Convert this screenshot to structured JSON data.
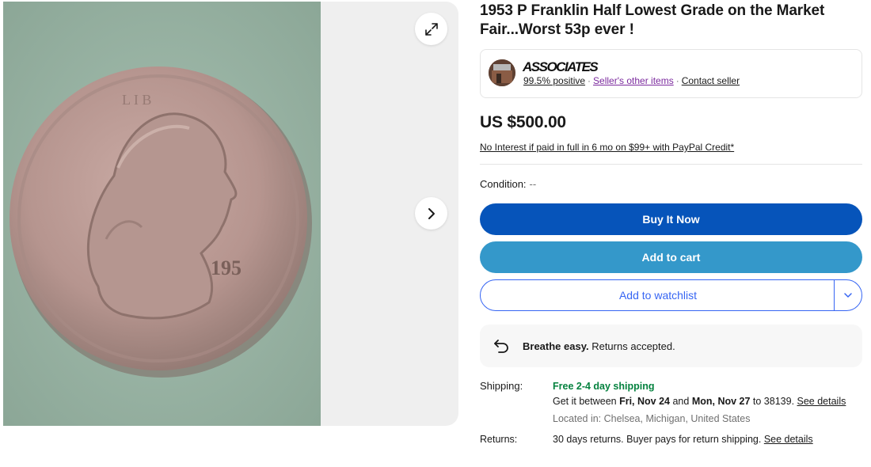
{
  "listing": {
    "title": "1953 P Franklin Half Lowest Grade on the Market Fair...Worst 53p ever !"
  },
  "gallery": {
    "photo_alt": "Coin photo",
    "expand_icon": "expand-icon",
    "next_icon": "chevron-right-icon"
  },
  "seller": {
    "name": "ASSOCIATES",
    "feedback": "99.5% positive",
    "other_items": "Seller's other items",
    "contact": "Contact seller"
  },
  "price": {
    "amount": "US $500.00",
    "credit_offer": "No Interest if paid in full in 6 mo on $99+ with PayPal Credit*"
  },
  "condition": {
    "label": "Condition:",
    "value": "--"
  },
  "actions": {
    "buy_now": "Buy It Now",
    "add_to_cart": "Add to cart",
    "add_to_watchlist": "Add to watchlist"
  },
  "returns_banner": {
    "bold": "Breathe easy.",
    "text": " Returns accepted."
  },
  "shipping": {
    "label": "Shipping:",
    "free": "Free 2-4 day shipping",
    "get_it_prefix": "Get it between ",
    "date_start": "Fri, Nov 24",
    "and": " and ",
    "date_end": "Mon, Nov 27",
    "to_zip": " to 38139. ",
    "see_details": "See details",
    "location": "Located in: Chelsea, Michigan, United States"
  },
  "returns": {
    "label": "Returns:",
    "text": "30 days returns. Buyer pays for return shipping. ",
    "see_details": "See details"
  },
  "colors": {
    "buy_button": "#0654ba",
    "cart_button": "#3498ca",
    "watch_border": "#3665f3",
    "free_shipping": "#05823f"
  }
}
